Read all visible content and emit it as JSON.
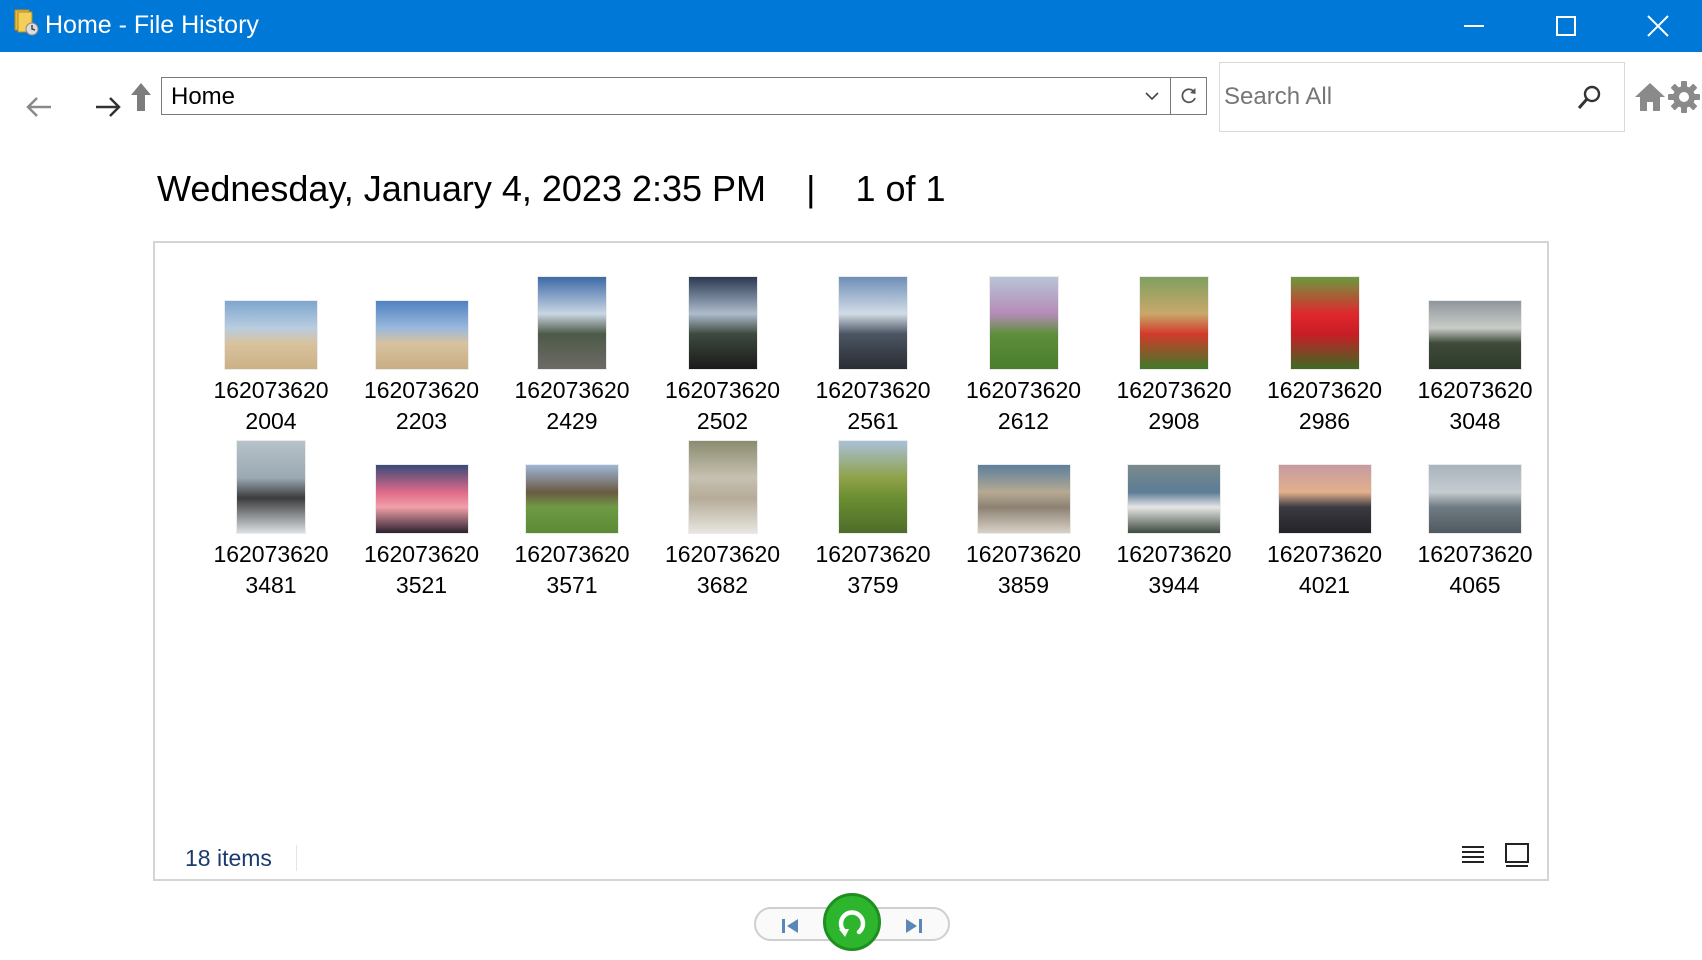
{
  "window": {
    "title": "Home - File History",
    "controls": [
      "minimize",
      "maximize",
      "close"
    ]
  },
  "toolbar": {
    "address_value": "Home",
    "search_placeholder": "Search All"
  },
  "heading": {
    "date": "Wednesday, January 4, 2023 2:35 PM",
    "separator": "|",
    "page": "1 of 1"
  },
  "items": [
    {
      "line1": "162073620",
      "line2": "2004",
      "orientation": "landscape",
      "colors": [
        "#7fa6cf",
        "#b9cde0",
        "#d8c39e",
        "#cdb086"
      ]
    },
    {
      "line1": "162073620",
      "line2": "2203",
      "orientation": "landscape",
      "colors": [
        "#4f82c2",
        "#9bb9dc",
        "#d7c2a0",
        "#c9ad84"
      ]
    },
    {
      "line1": "162073620",
      "line2": "2429",
      "orientation": "portrait",
      "colors": [
        "#3d6aa8",
        "#c9d6e2",
        "#4d5a48",
        "#6c6a66"
      ]
    },
    {
      "line1": "162073620",
      "line2": "2502",
      "orientation": "portrait",
      "colors": [
        "#2b3a52",
        "#aebccd",
        "#3e4a3f",
        "#1a1a1a"
      ]
    },
    {
      "line1": "162073620",
      "line2": "2561",
      "orientation": "portrait",
      "colors": [
        "#6f8fb8",
        "#d2dce6",
        "#4b5563",
        "#2a2d33"
      ]
    },
    {
      "line1": "162073620",
      "line2": "2612",
      "orientation": "portrait",
      "colors": [
        "#b8c4d6",
        "#b58bb8",
        "#5d8f3a",
        "#4a7d2d"
      ]
    },
    {
      "line1": "162073620",
      "line2": "2908",
      "orientation": "portrait",
      "colors": [
        "#7fa060",
        "#c9a86a",
        "#d23b2b",
        "#3f7a29"
      ]
    },
    {
      "line1": "162073620",
      "line2": "2986",
      "orientation": "portrait",
      "colors": [
        "#6a9a3e",
        "#e0282d",
        "#c81d25",
        "#3d6b24"
      ]
    },
    {
      "line1": "162073620",
      "line2": "3048",
      "orientation": "landscape",
      "colors": [
        "#8f969c",
        "#c9ccc8",
        "#3f4a3a",
        "#2e3a2b"
      ]
    },
    {
      "line1": "162073620",
      "line2": "3481",
      "orientation": "portrait",
      "colors": [
        "#b7c2c9",
        "#9aa9b3",
        "#3c3c3c",
        "#d9e0e4"
      ]
    },
    {
      "line1": "162073620",
      "line2": "3521",
      "orientation": "landscape",
      "colors": [
        "#3a4a78",
        "#e06a8a",
        "#f1a0a8",
        "#2b2230"
      ]
    },
    {
      "line1": "162073620",
      "line2": "3571",
      "orientation": "landscape",
      "colors": [
        "#9fb6d6",
        "#6a5a44",
        "#6f9a45",
        "#5c8a36"
      ]
    },
    {
      "line1": "162073620",
      "line2": "3682",
      "orientation": "portrait",
      "colors": [
        "#8a8c70",
        "#c7c1b1",
        "#b5ab98",
        "#e8e6e0"
      ]
    },
    {
      "line1": "162073620",
      "line2": "3759",
      "orientation": "portrait",
      "colors": [
        "#a9c0d8",
        "#8fa24a",
        "#6b8e31",
        "#4e6d2a"
      ]
    },
    {
      "line1": "162073620",
      "line2": "3859",
      "orientation": "landscape",
      "colors": [
        "#5c7f9a",
        "#b6aa94",
        "#8c8272",
        "#d8d2c6"
      ]
    },
    {
      "line1": "162073620",
      "line2": "3944",
      "orientation": "landscape",
      "colors": [
        "#7b8a8c",
        "#5b7d95",
        "#e6e6e6",
        "#3e4b3f"
      ]
    },
    {
      "line1": "162073620",
      "line2": "4021",
      "orientation": "landscape",
      "colors": [
        "#c79aa0",
        "#e2b08b",
        "#3b3a42",
        "#252328"
      ]
    },
    {
      "line1": "162073620",
      "line2": "4065",
      "orientation": "landscape",
      "colors": [
        "#a8b4bd",
        "#c6ccd0",
        "#6f7b83",
        "#505a60"
      ]
    }
  ],
  "status": {
    "item_count": "18 items"
  },
  "colors": {
    "titlebar": "#0078d7",
    "restore_button": "#2db52d",
    "status_text": "#1b3b6f"
  },
  "icons": {
    "back": "arrow-left-icon",
    "forward": "arrow-right-icon",
    "up": "arrow-up-icon",
    "refresh": "refresh-icon",
    "search": "search-icon",
    "home": "home-icon",
    "settings": "gear-icon",
    "details_view": "list-view-icon",
    "icon_view": "tile-view-icon",
    "previous": "skip-previous-icon",
    "next": "skip-next-icon",
    "restore": "restore-icon"
  }
}
